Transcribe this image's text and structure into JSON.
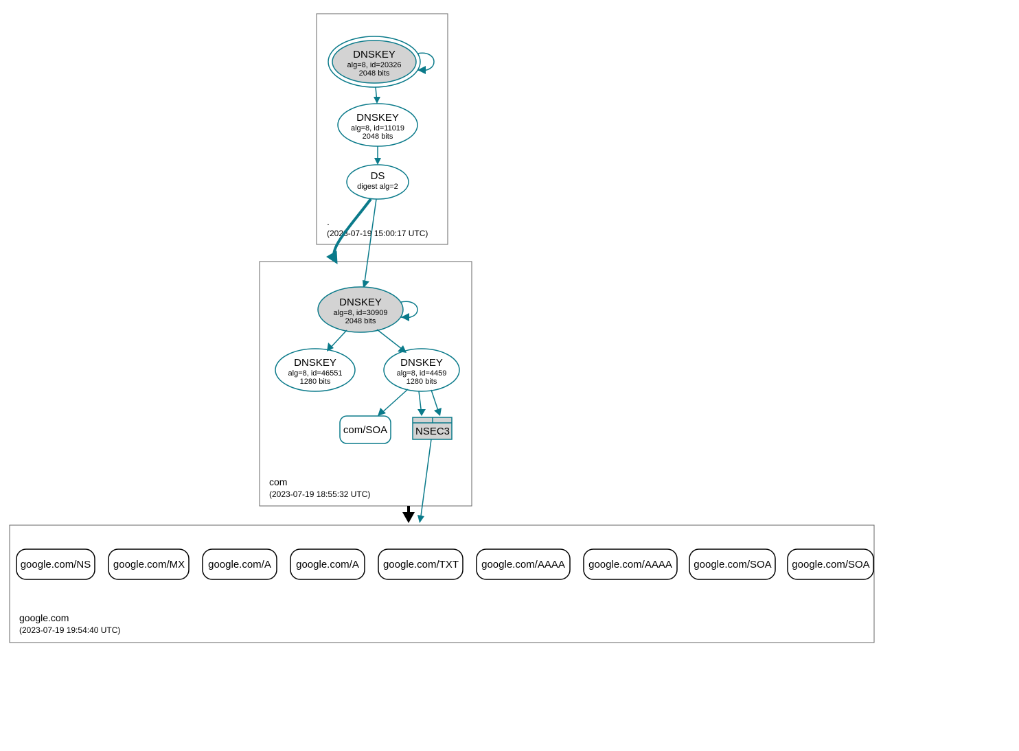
{
  "colors": {
    "teal": "#0a7a8a",
    "grey_fill": "#d3d3d3"
  },
  "zones": {
    "root": {
      "label": ".",
      "timestamp": "(2023-07-19 15:00:17 UTC)"
    },
    "com": {
      "label": "com",
      "timestamp": "(2023-07-19 18:55:32 UTC)"
    },
    "google": {
      "label": "google.com",
      "timestamp": "(2023-07-19 19:54:40 UTC)"
    }
  },
  "nodes": {
    "root_ksk": {
      "title": "DNSKEY",
      "line2": "alg=8, id=20326",
      "line3": "2048 bits"
    },
    "root_zsk": {
      "title": "DNSKEY",
      "line2": "alg=8, id=11019",
      "line3": "2048 bits"
    },
    "root_ds": {
      "title": "DS",
      "line2": "digest alg=2"
    },
    "com_ksk": {
      "title": "DNSKEY",
      "line2": "alg=8, id=30909",
      "line3": "2048 bits"
    },
    "com_zsk1": {
      "title": "DNSKEY",
      "line2": "alg=8, id=46551",
      "line3": "1280 bits"
    },
    "com_zsk2": {
      "title": "DNSKEY",
      "line2": "alg=8, id=4459",
      "line3": "1280 bits"
    },
    "com_soa": {
      "label": "com/SOA"
    },
    "com_nsec3": {
      "label": "NSEC3"
    }
  },
  "rrsets": {
    "r0": "google.com/NS",
    "r1": "google.com/MX",
    "r2": "google.com/A",
    "r3": "google.com/A",
    "r4": "google.com/TXT",
    "r5": "google.com/AAAA",
    "r6": "google.com/AAAA",
    "r7": "google.com/SOA",
    "r8": "google.com/SOA"
  }
}
